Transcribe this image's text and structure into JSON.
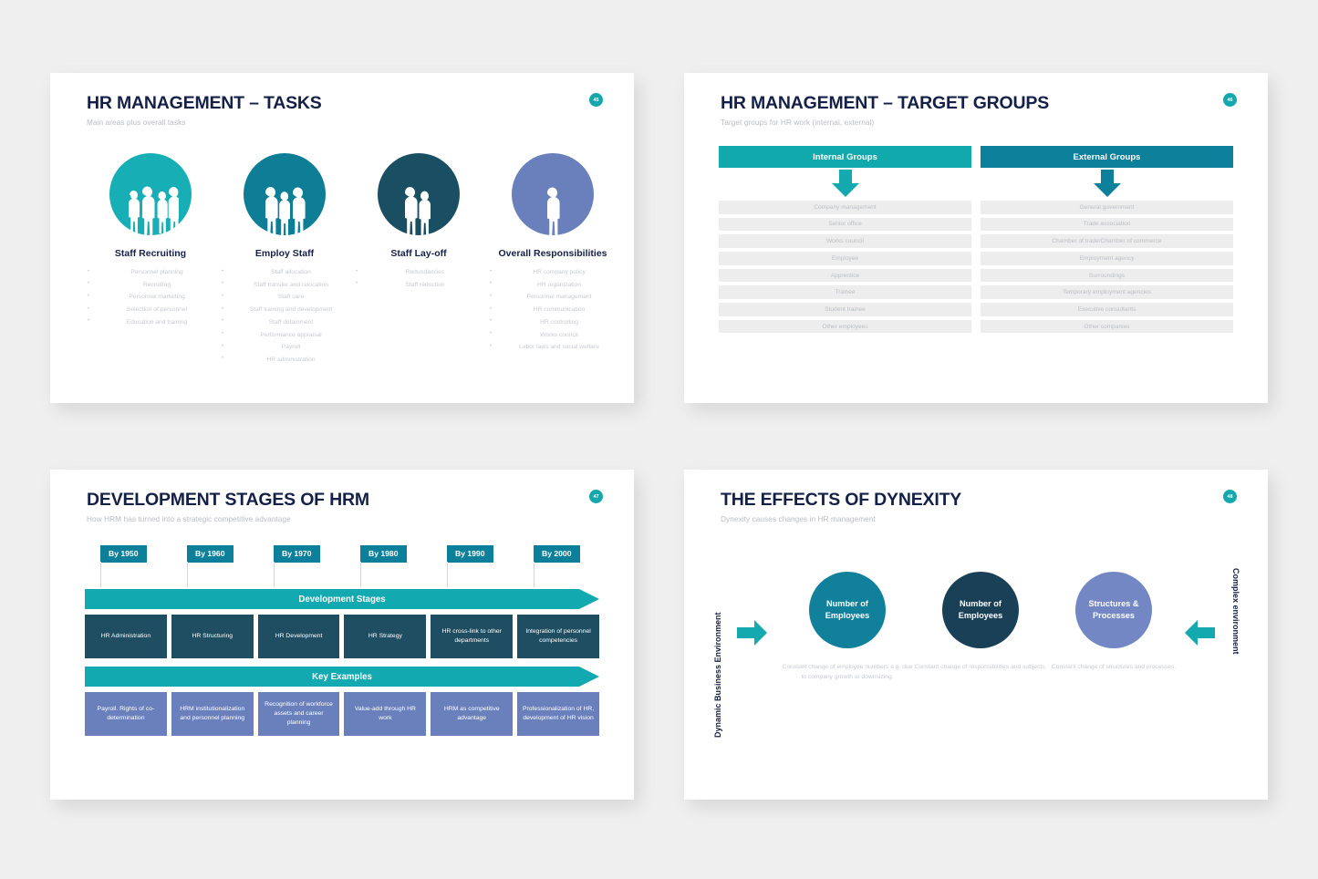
{
  "colors": {
    "teal_bright": "#17afb5",
    "teal_mid": "#0d7e96",
    "navy_deep": "#1a4f63",
    "periwinkle": "#6a80bc",
    "title_navy": "#152049",
    "muted_text": "#c8cbd2"
  },
  "slides": [
    {
      "id": "hr-management-tasks",
      "title": "HR MANAGEMENT – TASKS",
      "subtitle": "Main areas plus overall tasks",
      "page": "45",
      "columns": [
        {
          "heading": "Staff Recruiting",
          "icon": "four-people-icon",
          "people": 4,
          "color": "#17afb5",
          "bullets": [
            "Personnel planning",
            "Recruiting",
            "Personnel marketing",
            "Selection of personnel",
            "Education and training"
          ]
        },
        {
          "heading": "Employ Staff",
          "icon": "three-people-icon",
          "people": 3,
          "color": "#0d7e96",
          "bullets": [
            "Staff allocation",
            "Staff transfer and relocation",
            "Staff care",
            "Staff training and development",
            "Staff detainment",
            "Performance appraisal",
            "Payroll",
            "HR administration"
          ]
        },
        {
          "heading": "Staff Lay-off",
          "icon": "two-people-icon",
          "people": 2,
          "color": "#1a4f63",
          "bullets": [
            "Redundancies",
            "Staff reduction"
          ]
        },
        {
          "heading": "Overall Responsibilities",
          "icon": "one-person-icon",
          "people": 1,
          "color": "#6a80bc",
          "bullets": [
            "HR company policy",
            "HR organization",
            "Personnel management",
            "HR communication",
            "HR controlling",
            "Works council",
            "Labor laws and social welfare"
          ]
        }
      ]
    },
    {
      "id": "hr-management-target-groups",
      "title": "HR MANAGEMENT – TARGET GROUPS",
      "subtitle": "Target groups for HR work (internal, external)",
      "page": "46",
      "groups": [
        {
          "header": "Internal Groups",
          "color": "#11a9ab",
          "items": [
            "Company management",
            "Senior office",
            "Works council",
            "Employee",
            "Apprentice",
            "Trainee",
            "Student trainee",
            "Other employees"
          ]
        },
        {
          "header": "External Groups",
          "color": "#0c7f9b",
          "items": [
            "General government",
            "Trade association",
            "Chamber of trade/Chamber of commerce",
            "Employment agency",
            "Surroundings",
            "Temporary employment agencies",
            "Executive consultants",
            "Other companies"
          ]
        }
      ]
    },
    {
      "id": "development-stages-of-hrm",
      "title": "DEVELOPMENT STAGES OF HRM",
      "subtitle": "How HRM has turned into a strategic competitive advantage",
      "page": "47",
      "flags": [
        "By 1950",
        "By 1960",
        "By 1970",
        "By 1980",
        "By 1990",
        "By 2000"
      ],
      "band_1_label": "Development Stages",
      "stages": [
        "HR Administration",
        "HR Structuring",
        "HR Development",
        "HR Strategy",
        "HR cross-link to other departments",
        "Integration of personnel competencies"
      ],
      "band_2_label": "Key Examples",
      "examples": [
        "Payroll. Rights of co-determination",
        "HRM institutionalization and personnel planning",
        "Recognition of workforce assets and career planning",
        "Value-add through HR work",
        "HRM as competitive advantage",
        "Professionalization of HR, development of HR vision"
      ]
    },
    {
      "id": "the-effects-of-dynexity",
      "title": "THE EFFECTS OF DYNEXITY",
      "subtitle": "Dynexity causes changes in HR management",
      "page": "48",
      "axis_left": "Dynamic Business Environment",
      "axis_right": "Complex environment",
      "items": [
        {
          "label": "Number of Employees",
          "color": "#11809a",
          "caption": "Constant change of employee numbers e.g. due to company growth or downsizing."
        },
        {
          "label": "Number of Employees",
          "color": "#1a4057",
          "caption": "Constant change of responsibilities and subjects."
        },
        {
          "label": "Structures & Processes",
          "color": "#7287c4",
          "caption": "Constant change of structures and processes."
        }
      ]
    }
  ]
}
